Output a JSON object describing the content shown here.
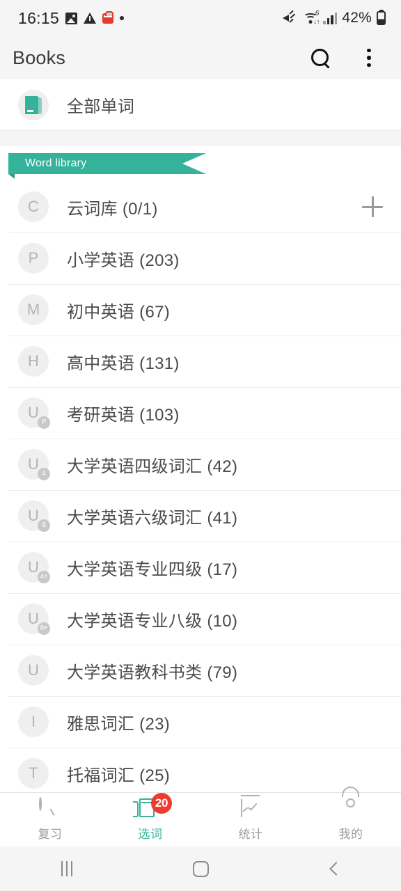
{
  "status_bar": {
    "time": "16:15",
    "battery_text": "42%",
    "icons": [
      "photo-icon",
      "warning-icon",
      "red-app-icon",
      "dot-icon",
      "mute-icon",
      "wifi-icon",
      "signal-icon",
      "battery-icon"
    ]
  },
  "app_bar": {
    "title": "Books",
    "search_icon": "search-icon",
    "overflow_icon": "more-vertical-icon"
  },
  "all_words": {
    "label": "全部单词",
    "icon": "book-icon"
  },
  "library": {
    "ribbon_label": "Word library",
    "add_icon": "plus-icon",
    "items": [
      {
        "initial": "C",
        "badge": "",
        "label": "云词库 (0/1)",
        "has_add": true
      },
      {
        "initial": "P",
        "badge": "",
        "label": "小学英语 (203)",
        "has_add": false
      },
      {
        "initial": "M",
        "badge": "",
        "label": "初中英语 (67)",
        "has_add": false
      },
      {
        "initial": "H",
        "badge": "",
        "label": "高中英语 (131)",
        "has_add": false
      },
      {
        "initial": "U",
        "badge": "P",
        "label": "考研英语 (103)",
        "has_add": false
      },
      {
        "initial": "U",
        "badge": "4",
        "label": "大学英语四级词汇 (42)",
        "has_add": false
      },
      {
        "initial": "U",
        "badge": "6",
        "label": "大学英语六级词汇 (41)",
        "has_add": false
      },
      {
        "initial": "U",
        "badge": "4+",
        "label": "大学英语专业四级 (17)",
        "has_add": false
      },
      {
        "initial": "U",
        "badge": "8+",
        "label": "大学英语专业八级 (10)",
        "has_add": false
      },
      {
        "initial": "U",
        "badge": "",
        "label": "大学英语教科书类 (79)",
        "has_add": false
      },
      {
        "initial": "I",
        "badge": "",
        "label": "雅思词汇 (23)",
        "has_add": false
      },
      {
        "initial": "T",
        "badge": "",
        "label": "托福词汇 (25)",
        "has_add": false
      }
    ]
  },
  "tab_bar": {
    "tabs": [
      {
        "label": "复习",
        "icon": "clock-icon",
        "active": false,
        "badge": ""
      },
      {
        "label": "选词",
        "icon": "book-icon",
        "active": true,
        "badge": "20"
      },
      {
        "label": "统计",
        "icon": "chart-icon",
        "active": false,
        "badge": ""
      },
      {
        "label": "我的",
        "icon": "person-icon",
        "active": false,
        "badge": ""
      }
    ]
  },
  "system_nav": {
    "recents_icon": "recents-icon",
    "home_icon": "home-icon",
    "back_icon": "back-icon"
  },
  "colors": {
    "accent": "#35b39a",
    "badge_red": "#ee3b30",
    "background": "#f5f5f5",
    "card": "#ffffff"
  }
}
